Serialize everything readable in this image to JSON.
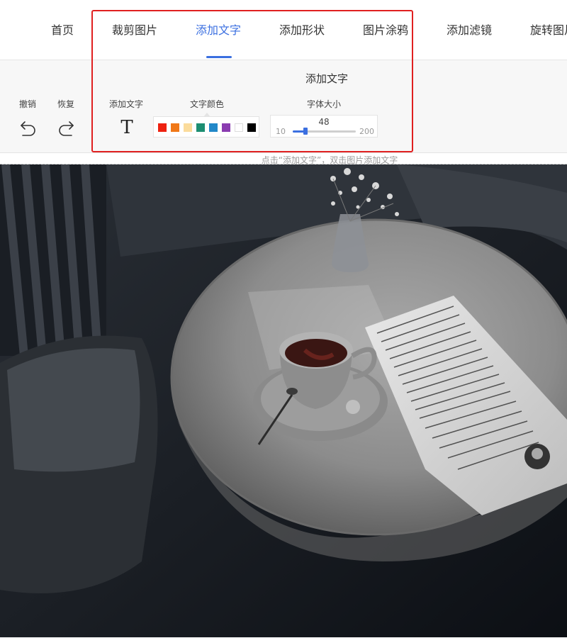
{
  "nav": {
    "items": [
      {
        "label": "首页",
        "active": false
      },
      {
        "label": "裁剪图片",
        "active": false
      },
      {
        "label": "添加文字",
        "active": true
      },
      {
        "label": "添加形状",
        "active": false
      },
      {
        "label": "图片涂鸦",
        "active": false
      },
      {
        "label": "添加滤镜",
        "active": false
      },
      {
        "label": "旋转图片",
        "active": false
      }
    ],
    "accent_color": "#3b6fe0"
  },
  "panel": {
    "title": "添加文字",
    "undo_label": "撤销",
    "redo_label": "恢复",
    "add_text_label": "添加文字",
    "add_text_icon": "T",
    "text_color_label": "文字颜色",
    "font_size_label": "字体大小",
    "swatches": [
      "#ee2211",
      "#f07818",
      "#fbdc9c",
      "#1d8e72",
      "#2288c8",
      "#8a3cb0",
      "#ffffff",
      "#000000"
    ],
    "font_size": {
      "value": "48",
      "min": "10",
      "max": "200",
      "current": 48
    }
  },
  "hint": "点击“添加文字”，双击图片添加文字",
  "highlight_color": "#e02020"
}
